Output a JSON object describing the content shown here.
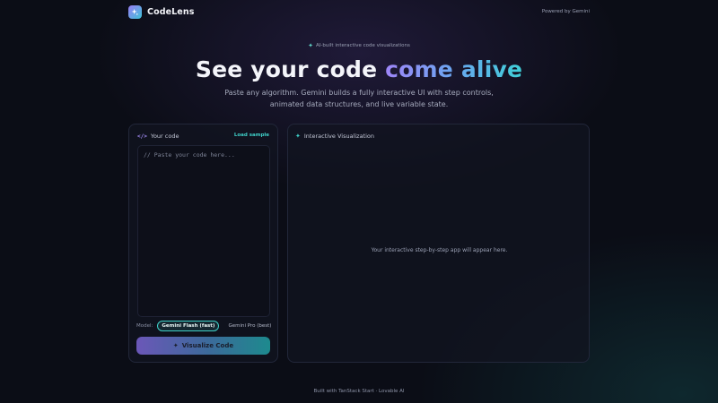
{
  "brand": {
    "name": "CodeLens",
    "logo_icon": "sparkles-icon"
  },
  "powered_by": "Powered by Gemini",
  "hero": {
    "eyebrow": "AI-built interactive code visualizations",
    "title_plain": "See your code ",
    "title_accent": "come alive",
    "subtitle": "Paste any algorithm. Gemini builds a fully interactive UI with step controls, animated data structures, and live variable state."
  },
  "code_panel": {
    "title": "Your code",
    "load_sample": "Load sample",
    "placeholder": "// Paste your code here...",
    "value": "",
    "model_label": "Model:",
    "models": [
      {
        "label": "Gemini Flash (fast)",
        "selected": true
      },
      {
        "label": "Gemini Pro (best)",
        "selected": false
      }
    ],
    "submit_label": "Visualize Code"
  },
  "viz_panel": {
    "title": "Interactive Visualization",
    "empty_text": "Your interactive step-by-step app will appear here."
  },
  "footer": "Built with TanStack Start · Lovable AI",
  "colors": {
    "background": "#0b0d16",
    "accent_purple": "#9f86f8",
    "accent_teal": "#3fd0c8"
  }
}
